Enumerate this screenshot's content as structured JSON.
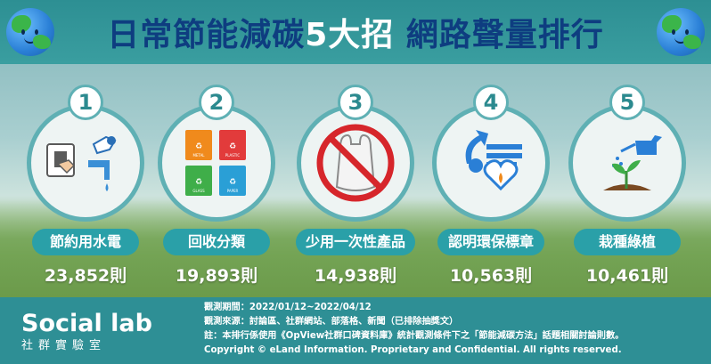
{
  "header": {
    "title_part1": "日常節能減碳",
    "title_highlight": "5大招",
    "title_part2": " 網路聲量排行",
    "left_icon": "smiling-earth-icon",
    "right_icon": "smiling-earth-icon"
  },
  "cards": [
    {
      "rank": "1",
      "label": "節約用水電",
      "count": "23,852則",
      "icon": "water-electricity-saving-icon"
    },
    {
      "rank": "2",
      "label": "回收分類",
      "count": "19,893則",
      "icon": "recycling-bins-icon",
      "bins": [
        "METAL",
        "PLASTIC",
        "GLASS",
        "PAPER"
      ]
    },
    {
      "rank": "3",
      "label": "少用一次性產品",
      "count": "14,938則",
      "icon": "no-plastic-bag-icon"
    },
    {
      "rank": "4",
      "label": "認明環保標章",
      "count": "10,563則",
      "icon": "eco-label-icon"
    },
    {
      "rank": "5",
      "label": "栽種綠植",
      "count": "10,461則",
      "icon": "watering-plant-icon"
    }
  ],
  "footer": {
    "brand_name": "Social lab",
    "brand_sub": "社群實驗室",
    "period": "觀測期間：2022/01/12~2022/04/12",
    "sources": "觀測來源：討論區、社群網站、部落格、新聞（已排除抽獎文）",
    "note": "註：本排行係使用《OpView社群口碑資料庫》統計觀測條件下之「節能減碳方法」話題相關討論則數。",
    "copyright": "Copyright © eLand Information. Proprietary and Confidential. All rights reserved."
  },
  "colors": {
    "title_blue": "#0e3d80",
    "accent_teal": "#2aa0a8",
    "ring_teal": "#5fb0b4",
    "footer_teal": "#2e8f95"
  }
}
